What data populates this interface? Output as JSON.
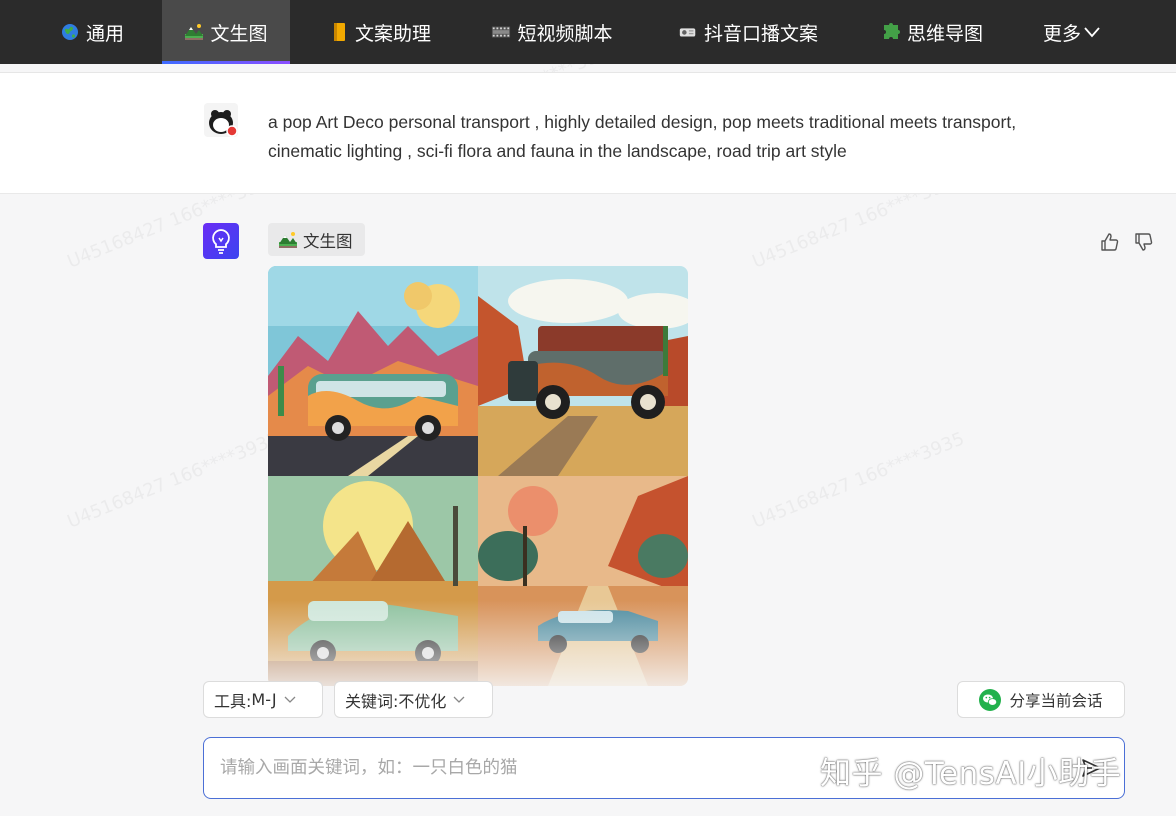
{
  "nav": {
    "items": [
      {
        "label": "通用",
        "icon": "globe-icon"
      },
      {
        "label": "文生图",
        "icon": "landscape-icon",
        "active": true
      },
      {
        "label": "文案助理",
        "icon": "notebook-icon"
      },
      {
        "label": "短视频脚本",
        "icon": "film-icon"
      },
      {
        "label": "抖音口播文案",
        "icon": "projector-icon"
      },
      {
        "label": "思维导图",
        "icon": "puzzle-icon"
      },
      {
        "label": "更多",
        "icon": "chevron-down-icon"
      }
    ]
  },
  "user_message": {
    "text": "a pop Art Deco personal transport , highly detailed design, pop meets traditional meets transport, cinematic lighting , sci-fi flora and fauna in the landscape, road trip art style"
  },
  "assistant_message": {
    "tool_tag": "文生图",
    "image_grid": [
      "retro-bus-in-desert-canyon",
      "vintage-truck-in-red-rock-desert",
      "classic-green-sedan-under-yellow-sun",
      "vintage-car-on-desert-road-with-palms"
    ]
  },
  "controls": {
    "tool_label": "工具:",
    "tool_value": "M-J",
    "keyword_label": "关键词:",
    "keyword_value": "不优化",
    "share_label": "分享当前会话"
  },
  "input": {
    "placeholder": "请输入画面关键词，如：一只白色的猫"
  },
  "watermark": {
    "signature": "知乎 @TensAI小助手",
    "user_code": "U45168427 166****3935"
  },
  "colors": {
    "nav_bg": "#2b2b2b",
    "accent": "#4b6fd6",
    "bot_avatar": "#5a33f2"
  }
}
